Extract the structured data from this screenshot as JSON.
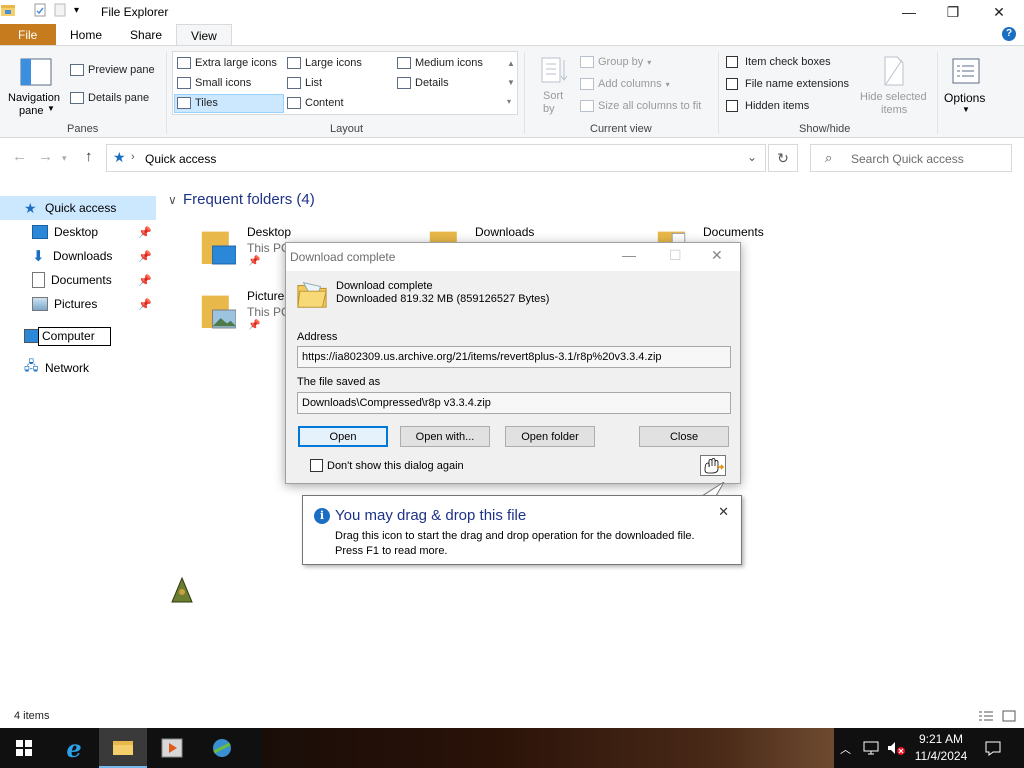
{
  "window": {
    "title": "File Explorer"
  },
  "ribbon": {
    "tabs": [
      "File",
      "Home",
      "Share",
      "View"
    ],
    "panes": {
      "navigation_pane": "Navigation",
      "navigation_pane_2": "pane",
      "preview_pane": "Preview pane",
      "details_pane": "Details pane",
      "group_label": "Panes"
    },
    "layout": {
      "extra_large_icons": "Extra large icons",
      "large_icons": "Large icons",
      "medium_icons": "Medium icons",
      "small_icons": "Small icons",
      "list": "List",
      "details": "Details",
      "tiles": "Tiles",
      "content": "Content",
      "group_label": "Layout"
    },
    "current_view": {
      "sort_by": "Sort",
      "sort_by_2": "by",
      "group_by": "Group by",
      "add_columns": "Add columns",
      "size_all_columns": "Size all columns to fit",
      "group_label": "Current view"
    },
    "show_hide": {
      "item_check_boxes": "Item check boxes",
      "file_name_extensions": "File name extensions",
      "hidden_items": "Hidden items",
      "hide_selected": "Hide selected",
      "hide_selected_2": "items",
      "group_label": "Show/hide"
    },
    "options": "Options"
  },
  "address_bar": {
    "path": "Quick access",
    "search_placeholder": "Search Quick access"
  },
  "sidebar": {
    "quick_access": "Quick access",
    "desktop": "Desktop",
    "downloads": "Downloads",
    "documents": "Documents",
    "pictures": "Pictures",
    "computer_rename": "Computer",
    "network": "Network"
  },
  "content": {
    "section_title": "Frequent folders (4)",
    "folders": [
      {
        "name": "Desktop",
        "sub": "This PC"
      },
      {
        "name": "Downloads",
        "sub": ""
      },
      {
        "name": "Documents",
        "sub": ""
      },
      {
        "name": "Pictures",
        "sub": "This PC"
      }
    ]
  },
  "dialog": {
    "title": "Download complete",
    "heading": "Download complete",
    "downloaded": "Downloaded 819.32  MB (859126527 Bytes)",
    "address_label": "Address",
    "address_value": "https://ia802309.us.archive.org/21/items/revert8plus-3.1/r8p%20v3.3.4.zip",
    "saved_label": "The file saved as",
    "saved_value": "Downloads\\Compressed\\r8p v3.3.4.zip",
    "btn_open": "Open",
    "btn_open_with": "Open with...",
    "btn_open_folder": "Open folder",
    "btn_close": "Close",
    "dont_show": "Don't show this dialog again"
  },
  "balloon": {
    "title": "You may drag & drop this file",
    "line1": "Drag this icon to start the drag and drop operation for the downloaded file.",
    "line2": "Press F1 to read more."
  },
  "status_bar": {
    "items": "4 items"
  },
  "taskbar": {
    "time": "9:21 AM",
    "date": "11/4/2024"
  },
  "colors": {
    "file_tab": "#c57b1e",
    "selection": "#cce8ff",
    "accent_blue": "#0078d7",
    "heading_blue": "#1e3287"
  }
}
